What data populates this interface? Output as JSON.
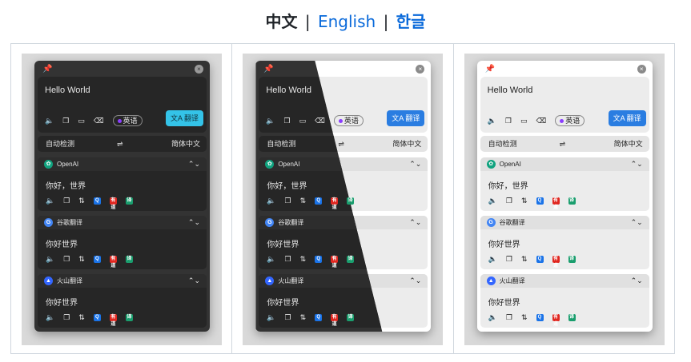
{
  "language_bar": {
    "current": "中文",
    "separator": "|",
    "english": "English",
    "korean": "한글"
  },
  "window": {
    "pin_glyph": "📌",
    "close_glyph": "×",
    "source_text": "Hello World",
    "source_lang": "英语",
    "translate_button": "翻译",
    "translate_icon": "文A",
    "lang_from": "自动检测",
    "swap_glyph": "⇌",
    "lang_to": "简体中文",
    "source_icons": [
      "🔈",
      "❐",
      "▭",
      "⌫"
    ],
    "result_icons": [
      "🔈",
      "❐",
      "⇅"
    ],
    "chevron_glyph": "⌃⌄",
    "services": [
      {
        "name": "OpenAI",
        "logo": "✿",
        "color": "#10a37f",
        "text": "你好，世界"
      },
      {
        "name": "谷歌翻译",
        "logo": "G",
        "color": "#4285f4",
        "text": "你好世界"
      },
      {
        "name": "火山翻译",
        "logo": "▲",
        "color": "#3366ff",
        "text": "你好世界"
      }
    ],
    "service_icons": [
      {
        "glyph": "Q",
        "color": "#1a73e8"
      },
      {
        "glyph": "有道",
        "color": "#e0261f"
      },
      {
        "glyph": "译",
        "color": "#1a9e6e"
      }
    ]
  },
  "colors": {
    "link": "#0969da",
    "translate_light": "#2a7de1",
    "translate_dark": "#34c3e8"
  }
}
